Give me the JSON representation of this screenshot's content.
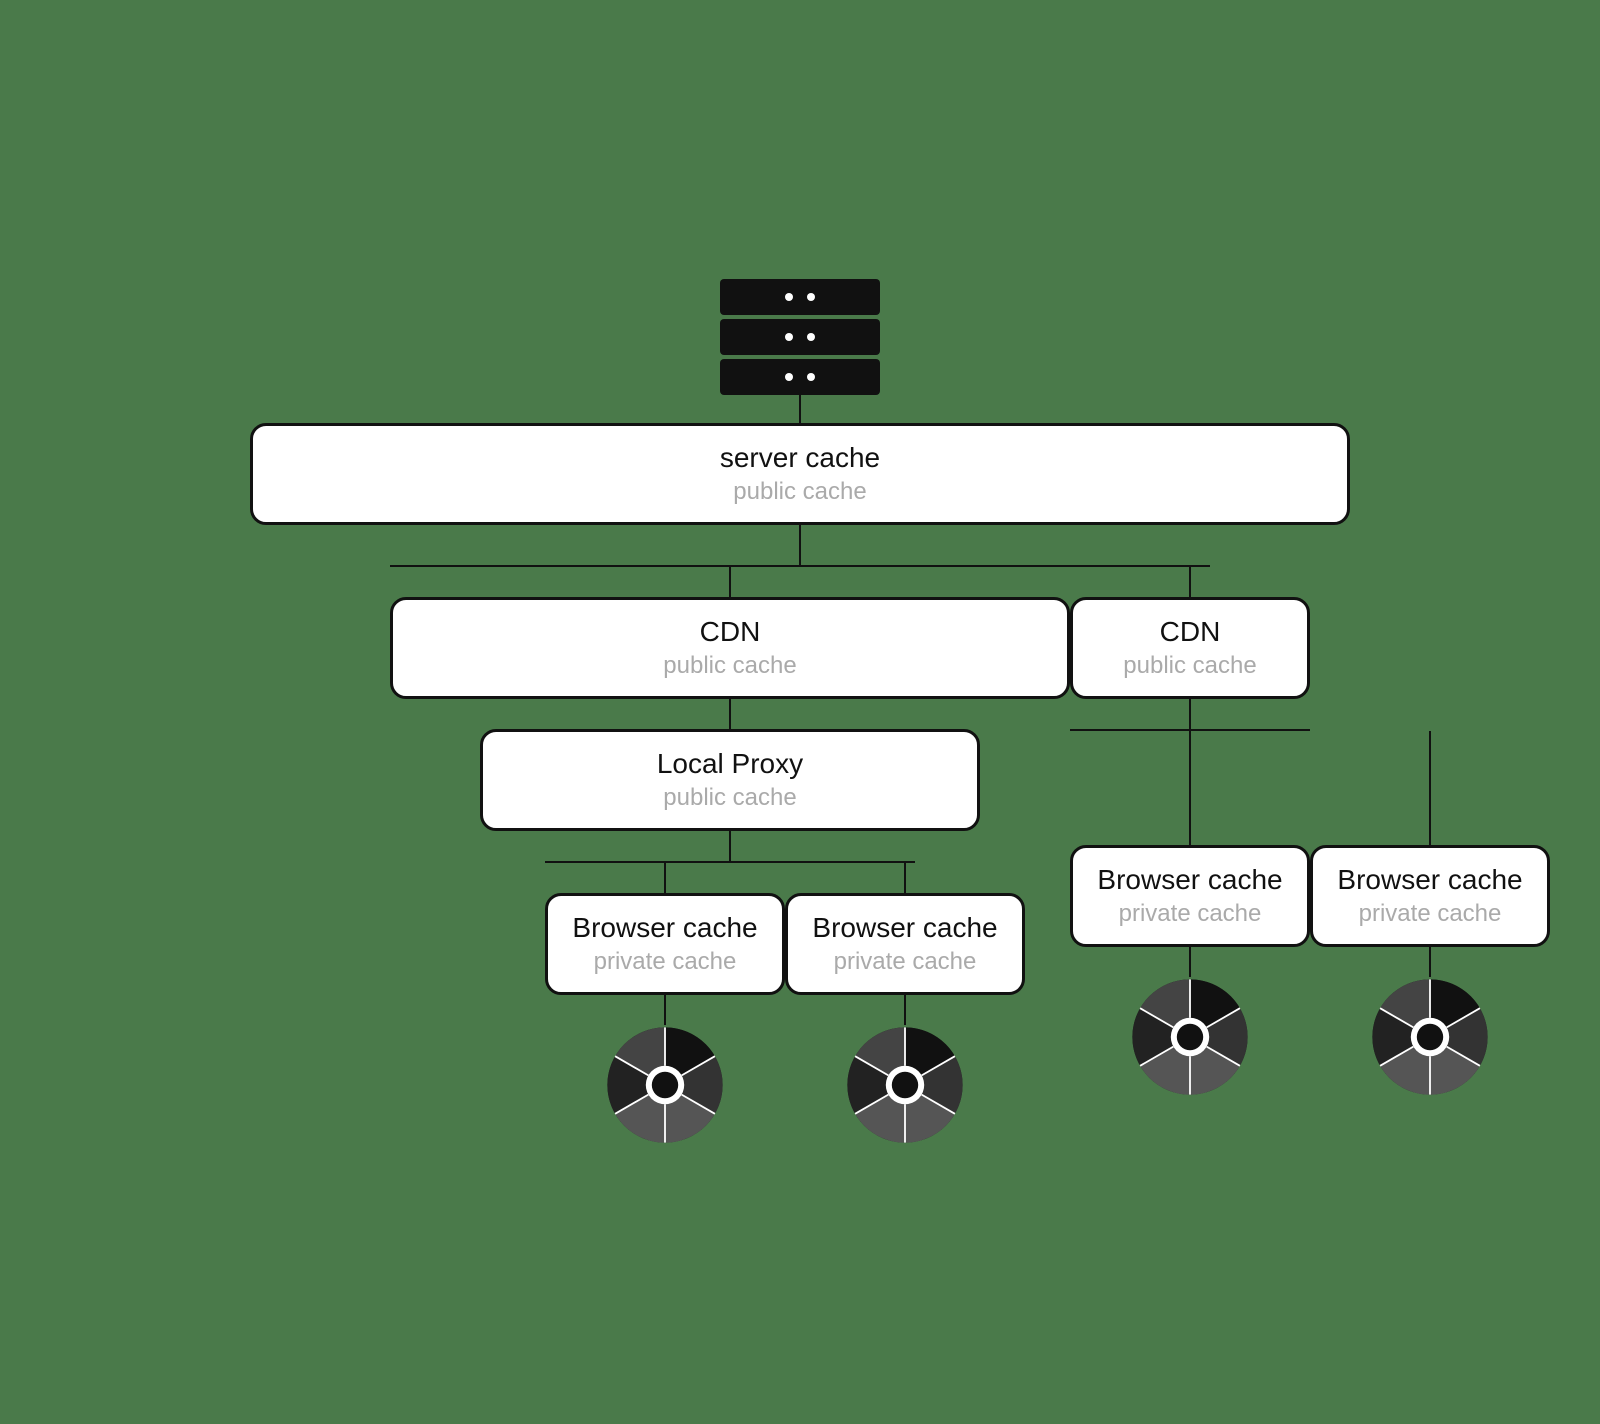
{
  "server": {
    "title": "server cache",
    "subtitle": "public cache"
  },
  "cdn_left": {
    "title": "CDN",
    "subtitle": "public cache"
  },
  "cdn_right": {
    "title": "CDN",
    "subtitle": "public cache"
  },
  "local_proxy": {
    "title": "Local Proxy",
    "subtitle": "public cache"
  },
  "browser_caches": [
    {
      "title": "Browser cache",
      "subtitle": "private cache"
    },
    {
      "title": "Browser cache",
      "subtitle": "private cache"
    },
    {
      "title": "Browser cache",
      "subtitle": "private cache"
    },
    {
      "title": "Browser cache",
      "subtitle": "private cache"
    }
  ]
}
